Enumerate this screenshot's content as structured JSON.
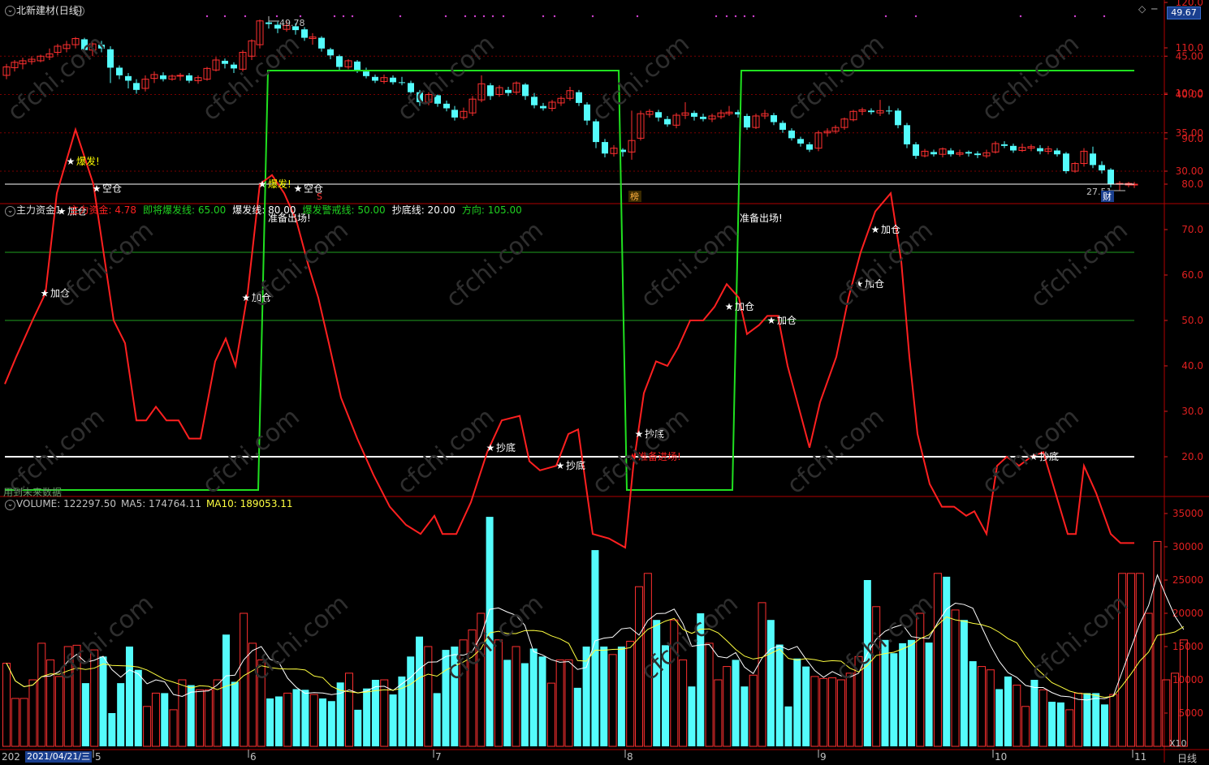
{
  "title": {
    "name": "北新建材",
    "period": "(日线)"
  },
  "right_boxes": {
    "price": "49.67",
    "x10": "X10",
    "period_label": "日线"
  },
  "price_axis": [
    "45.00",
    "40.00",
    "35.00",
    "30.00"
  ],
  "price_annotations": {
    "high_label": "49.78",
    "low_label": "27.51",
    "badge_s": "S",
    "badge_bang": "榜",
    "badge_cai": "财"
  },
  "indicator": {
    "name": "主力资金1",
    "legend": [
      {
        "label": "主力资金: 4.78",
        "color": "#ff2020"
      },
      {
        "label": "即将爆发线: 65.00",
        "color": "#20d020"
      },
      {
        "label": "爆发线: 80.00",
        "color": "#ffffff"
      },
      {
        "label": "爆发警戒线: 50.00",
        "color": "#20d020"
      },
      {
        "label": "抄底线: 20.00",
        "color": "#ffffff"
      },
      {
        "label": "方向: 105.00",
        "color": "#20d020"
      }
    ],
    "axis": [
      "120.0",
      "110.0",
      "100.0",
      "90.0",
      "80.0",
      "70.0",
      "60.0",
      "50.0",
      "40.0",
      "30.0",
      "20.0"
    ],
    "bottom_note": "用到未来数据",
    "top_notes": [
      "准备出场!",
      "准备出场!"
    ],
    "markers": [
      {
        "text": "加仓",
        "color": "#ffffff"
      },
      {
        "text": "加仓",
        "color": "#ffffff"
      },
      {
        "text": "爆发!",
        "color": "#ffff00"
      },
      {
        "text": "空仓",
        "color": "#ffffff"
      },
      {
        "text": "加仓",
        "color": "#ffffff"
      },
      {
        "text": "爆发!",
        "color": "#ffff00"
      },
      {
        "text": "空仓",
        "color": "#ffffff"
      },
      {
        "text": "抄底",
        "color": "#ffffff"
      },
      {
        "text": "抄底",
        "color": "#ffffff"
      },
      {
        "text": "抄底",
        "color": "#ffffff"
      },
      {
        "text": "准备进场!",
        "color": "#ff2020"
      },
      {
        "text": "加仓",
        "color": "#ffffff"
      },
      {
        "text": "加仓",
        "color": "#ffffff"
      },
      {
        "text": "加仓",
        "color": "#ffffff"
      },
      {
        "text": "加仓",
        "color": "#ffffff"
      },
      {
        "text": "抄底",
        "color": "#ffffff"
      }
    ]
  },
  "volume": {
    "legend": [
      {
        "label": "VOLUME: 122297.50",
        "color": "#c0c0c0"
      },
      {
        "label": "MA5: 174764.11",
        "color": "#c0c0c0"
      },
      {
        "label": "MA10: 189053.11",
        "color": "#ffff40"
      }
    ],
    "axis": [
      "35000",
      "30000",
      "25000",
      "20000",
      "15000",
      "10000",
      "5000"
    ]
  },
  "x_axis": {
    "start": "202",
    "selected_date": "2021/04/21/三",
    "months": [
      "5",
      "6",
      "7",
      "8",
      "9",
      "10",
      "11"
    ]
  },
  "watermark": "cfchi.com",
  "colors": {
    "up": "#ff3030",
    "down": "#54fcfc",
    "grid": "#7a0000",
    "frame": "#b00000"
  }
}
